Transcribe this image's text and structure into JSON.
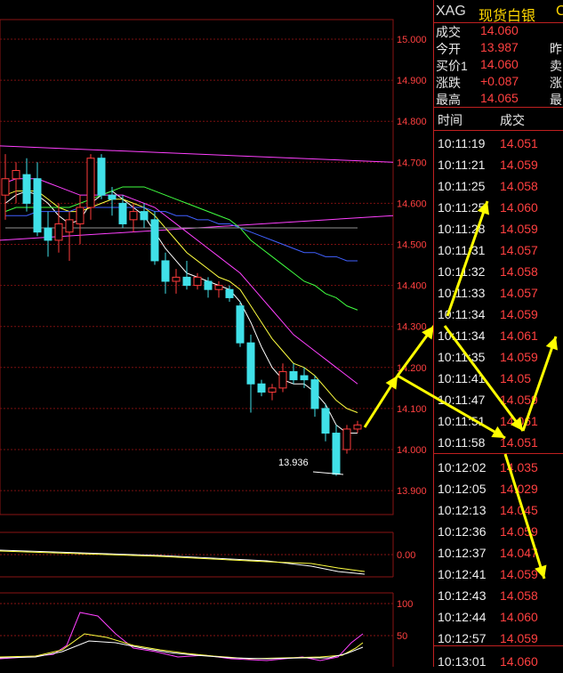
{
  "quote": {
    "symbol": "XAG",
    "name": "现货白银",
    "code_fragment": "C",
    "fields": [
      {
        "label": "成交",
        "value": "14.060",
        "label2": ""
      },
      {
        "label": "今开",
        "value": "13.987",
        "label2": "昨"
      },
      {
        "label": "买价1",
        "value": "14.060",
        "label2": "卖"
      },
      {
        "label": "涨跌",
        "value": "+0.087",
        "label2": "涨"
      },
      {
        "label": "最高",
        "value": "14.065",
        "label2": "最"
      }
    ],
    "table_headers": {
      "time": "时间",
      "price": "成交"
    },
    "ticks": [
      {
        "time": "10:11:19",
        "price": "14.051"
      },
      {
        "time": "10:11:21",
        "price": "14.059"
      },
      {
        "time": "10:11:25",
        "price": "14.058"
      },
      {
        "time": "10:11:25",
        "price": "14.060"
      },
      {
        "time": "10:11:28",
        "price": "14.059"
      },
      {
        "time": "10:11:31",
        "price": "14.057"
      },
      {
        "time": "10:11:32",
        "price": "14.058"
      },
      {
        "time": "10:11:33",
        "price": "14.057"
      },
      {
        "time": "10:11:34",
        "price": "14.059"
      },
      {
        "time": "10:11:34",
        "price": "14.061"
      },
      {
        "time": "10:11:35",
        "price": "14.059"
      },
      {
        "time": "10:11:41",
        "price": "14.05"
      },
      {
        "time": "10:11:47",
        "price": "14.059"
      },
      {
        "time": "10:11:51",
        "price": "14.061"
      },
      {
        "time": "10:11:58",
        "price": "14.051"
      },
      {
        "time": "10:12:02",
        "price": "14.035"
      },
      {
        "time": "10:12:05",
        "price": "14.029"
      },
      {
        "time": "10:12:13",
        "price": "14.045"
      },
      {
        "time": "10:12:36",
        "price": "14.059"
      },
      {
        "time": "10:12:37",
        "price": "14.047"
      },
      {
        "time": "10:12:41",
        "price": "14.059"
      },
      {
        "time": "10:12:43",
        "price": "14.058"
      },
      {
        "time": "10:12:44",
        "price": "14.060"
      },
      {
        "time": "10:12:57",
        "price": "14.059"
      },
      {
        "time": "10:13:01",
        "price": "14.060"
      }
    ]
  },
  "chart_data": [
    {
      "type": "candlestick",
      "panel": "price",
      "y_ticks": [
        "15.000",
        "14.900",
        "14.800",
        "14.700",
        "14.600",
        "14.500",
        "14.400",
        "14.300",
        "14.200",
        "14.100",
        "14.000",
        "13.900"
      ],
      "ylim": [
        13.88,
        15.0
      ],
      "low_annotation": "13.936",
      "colors": {
        "up": "#ff3b3b",
        "down": "#40e0e8",
        "grid": "#7a1010"
      },
      "candles": [
        {
          "o": 14.62,
          "h": 14.72,
          "l": 14.56,
          "c": 14.66
        },
        {
          "o": 14.66,
          "h": 14.7,
          "l": 14.6,
          "c": 14.68
        },
        {
          "o": 14.67,
          "h": 14.71,
          "l": 14.58,
          "c": 14.6
        },
        {
          "o": 14.66,
          "h": 14.7,
          "l": 14.52,
          "c": 14.53
        },
        {
          "o": 14.54,
          "h": 14.58,
          "l": 14.47,
          "c": 14.51
        },
        {
          "o": 14.51,
          "h": 14.6,
          "l": 14.48,
          "c": 14.55
        },
        {
          "o": 14.53,
          "h": 14.58,
          "l": 14.46,
          "c": 14.56
        },
        {
          "o": 14.55,
          "h": 14.62,
          "l": 14.5,
          "c": 14.59
        },
        {
          "o": 14.59,
          "h": 14.72,
          "l": 14.56,
          "c": 14.71
        },
        {
          "o": 14.71,
          "h": 14.72,
          "l": 14.61,
          "c": 14.62
        },
        {
          "o": 14.62,
          "h": 14.64,
          "l": 14.57,
          "c": 14.61
        },
        {
          "o": 14.6,
          "h": 14.62,
          "l": 14.54,
          "c": 14.55
        },
        {
          "o": 14.56,
          "h": 14.6,
          "l": 14.53,
          "c": 14.58
        },
        {
          "o": 14.58,
          "h": 14.6,
          "l": 14.54,
          "c": 14.56
        },
        {
          "o": 14.56,
          "h": 14.58,
          "l": 14.45,
          "c": 14.46
        },
        {
          "o": 14.46,
          "h": 14.48,
          "l": 14.38,
          "c": 14.41
        },
        {
          "o": 14.41,
          "h": 14.44,
          "l": 14.38,
          "c": 14.42
        },
        {
          "o": 14.42,
          "h": 14.46,
          "l": 14.39,
          "c": 14.4
        },
        {
          "o": 14.4,
          "h": 14.43,
          "l": 14.39,
          "c": 14.42
        },
        {
          "o": 14.41,
          "h": 14.42,
          "l": 14.37,
          "c": 14.39
        },
        {
          "o": 14.39,
          "h": 14.41,
          "l": 14.37,
          "c": 14.4
        },
        {
          "o": 14.39,
          "h": 14.4,
          "l": 14.36,
          "c": 14.37
        },
        {
          "o": 14.35,
          "h": 14.36,
          "l": 14.25,
          "c": 14.26
        },
        {
          "o": 14.26,
          "h": 14.28,
          "l": 14.09,
          "c": 14.16
        },
        {
          "o": 14.16,
          "h": 14.17,
          "l": 14.13,
          "c": 14.14
        },
        {
          "o": 14.14,
          "h": 14.16,
          "l": 14.12,
          "c": 14.15
        },
        {
          "o": 14.15,
          "h": 14.21,
          "l": 14.14,
          "c": 14.19
        },
        {
          "o": 14.19,
          "h": 14.21,
          "l": 14.16,
          "c": 14.17
        },
        {
          "o": 14.18,
          "h": 14.2,
          "l": 14.15,
          "c": 14.17
        },
        {
          "o": 14.17,
          "h": 14.18,
          "l": 14.08,
          "c": 14.1
        },
        {
          "o": 14.1,
          "h": 14.11,
          "l": 14.02,
          "c": 14.04
        },
        {
          "o": 14.04,
          "h": 14.06,
          "l": 13.936,
          "c": 13.94
        },
        {
          "o": 14.0,
          "h": 14.06,
          "l": 13.99,
          "c": 14.05
        },
        {
          "o": 14.05,
          "h": 14.07,
          "l": 14.04,
          "c": 14.06
        }
      ],
      "moving_averages": [
        {
          "color": "#ffffff",
          "values": [
            14.6,
            14.62,
            14.63,
            14.62,
            14.6,
            14.57,
            14.55,
            14.56,
            14.6,
            14.62,
            14.63,
            14.61,
            14.59,
            14.57,
            14.53,
            14.49,
            14.46,
            14.43,
            14.42,
            14.41,
            14.4,
            14.39,
            14.36,
            14.31,
            14.25,
            14.2,
            14.17,
            14.16,
            14.16,
            14.14,
            14.11,
            14.06,
            14.04,
            14.04
          ]
        },
        {
          "color": "#ffff40",
          "values": [
            14.62,
            14.63,
            14.63,
            14.63,
            14.61,
            14.59,
            14.58,
            14.58,
            14.59,
            14.6,
            14.61,
            14.61,
            14.6,
            14.59,
            14.57,
            14.54,
            14.51,
            14.48,
            14.46,
            14.44,
            14.42,
            14.41,
            14.39,
            14.35,
            14.31,
            14.27,
            14.24,
            14.21,
            14.2,
            14.18,
            14.15,
            14.12,
            14.1,
            14.09
          ]
        },
        {
          "color": "#ff40ff",
          "values": [
            14.65,
            14.66,
            14.66,
            14.66,
            14.65,
            14.64,
            14.63,
            14.62,
            14.62,
            14.62,
            14.62,
            14.62,
            14.61,
            14.6,
            14.59,
            14.57,
            14.55,
            14.53,
            14.51,
            14.49,
            14.47,
            14.45,
            14.43,
            14.4,
            14.37,
            14.34,
            14.31,
            14.28,
            14.26,
            14.24,
            14.22,
            14.2,
            14.18,
            14.16
          ]
        },
        {
          "color": "#40ff40",
          "values": [
            14.58,
            14.59,
            14.59,
            14.59,
            14.59,
            14.59,
            14.59,
            14.6,
            14.61,
            14.62,
            14.63,
            14.64,
            14.64,
            14.64,
            14.63,
            14.62,
            14.61,
            14.6,
            14.59,
            14.58,
            14.57,
            14.56,
            14.54,
            14.51,
            14.49,
            14.47,
            14.45,
            14.43,
            14.41,
            14.4,
            14.38,
            14.37,
            14.35,
            14.34
          ]
        },
        {
          "color": "#4060ff",
          "values": [
            14.57,
            14.57,
            14.57,
            14.58,
            14.58,
            14.58,
            14.58,
            14.59,
            14.59,
            14.59,
            14.59,
            14.59,
            14.59,
            14.59,
            14.58,
            14.58,
            14.57,
            14.57,
            14.56,
            14.56,
            14.55,
            14.55,
            14.54,
            14.53,
            14.52,
            14.51,
            14.5,
            14.49,
            14.48,
            14.48,
            14.47,
            14.47,
            14.46,
            14.46
          ]
        },
        {
          "color": "#909090",
          "values": [
            14.54,
            14.54,
            14.54,
            14.54,
            14.54,
            14.54,
            14.54,
            14.54,
            14.54,
            14.54,
            14.54,
            14.54,
            14.54,
            14.54,
            14.54,
            14.54,
            14.54,
            14.54,
            14.54,
            14.54,
            14.54,
            14.54,
            14.54,
            14.54,
            14.54,
            14.54,
            14.54,
            14.54,
            14.54,
            14.54,
            14.54,
            14.54,
            14.54,
            14.54
          ]
        }
      ],
      "trendlines": [
        {
          "color": "#ff40ff",
          "from": 14.74,
          "to": 14.7
        },
        {
          "color": "#ff40ff",
          "from": 14.51,
          "to": 14.57
        }
      ],
      "arrows_color": "#ffff00"
    },
    {
      "type": "line",
      "panel": "macd",
      "y_ticks": [
        "0.00"
      ],
      "ylim": [
        -0.05,
        0.05
      ]
    },
    {
      "type": "line",
      "panel": "kdj",
      "y_ticks": [
        "100",
        "50"
      ],
      "ylim": [
        0,
        110
      ]
    }
  ]
}
